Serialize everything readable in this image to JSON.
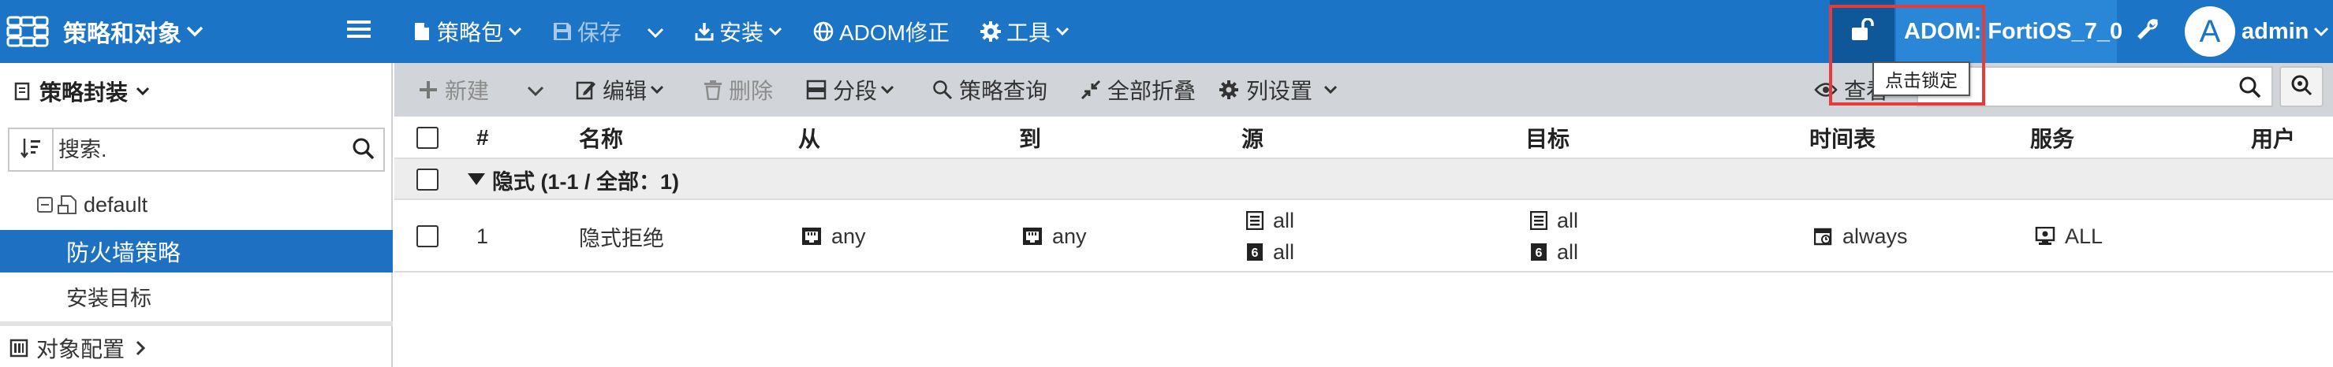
{
  "header": {
    "app_title": "策略和对象",
    "menus": [
      {
        "label": "策略包",
        "icon": "package-icon"
      },
      {
        "label": "保存",
        "icon": "save-icon"
      },
      {
        "label": "安装",
        "icon": "install-icon"
      },
      {
        "label": "ADOM修正",
        "icon": "globe-icon"
      },
      {
        "label": "工具",
        "icon": "gear-icon"
      }
    ],
    "adom": "ADOM: FortiOS_7_0",
    "lock_tooltip": "点击锁定",
    "avatar_letter": "A",
    "user": "admin",
    "colors": {
      "bar": "#1b74c5",
      "lock_bg": "#0e5899",
      "adom_bg": "#2a86d6",
      "highlight": "#e63b3b"
    }
  },
  "sidebar": {
    "title": "策略封装",
    "search_placeholder": "搜索.",
    "tree_root": "default",
    "items": [
      {
        "label": "防火墙策略",
        "selected": true
      },
      {
        "label": "安装目标",
        "selected": false
      }
    ],
    "object_config": "对象配置",
    "selected_color": "#1e71c2"
  },
  "toolbar": {
    "new": "新建",
    "edit": "编辑",
    "delete": "删除",
    "segment": "分段",
    "policy_query": "策略查询",
    "collapse_all": "全部折叠",
    "column_settings": "列设置",
    "view_partial": "查看"
  },
  "table": {
    "columns": [
      "#",
      "名称",
      "从",
      "到",
      "源",
      "目标",
      "时间表",
      "服务",
      "用户"
    ],
    "group_label": "隐式 (1-1 / 全部：1)",
    "rows": [
      {
        "seq": "1",
        "name": "隐式拒绝",
        "from": "any",
        "to": "any",
        "source": [
          "all",
          "all"
        ],
        "destination": [
          "all",
          "all"
        ],
        "schedule": "always",
        "service": "ALL"
      }
    ]
  }
}
